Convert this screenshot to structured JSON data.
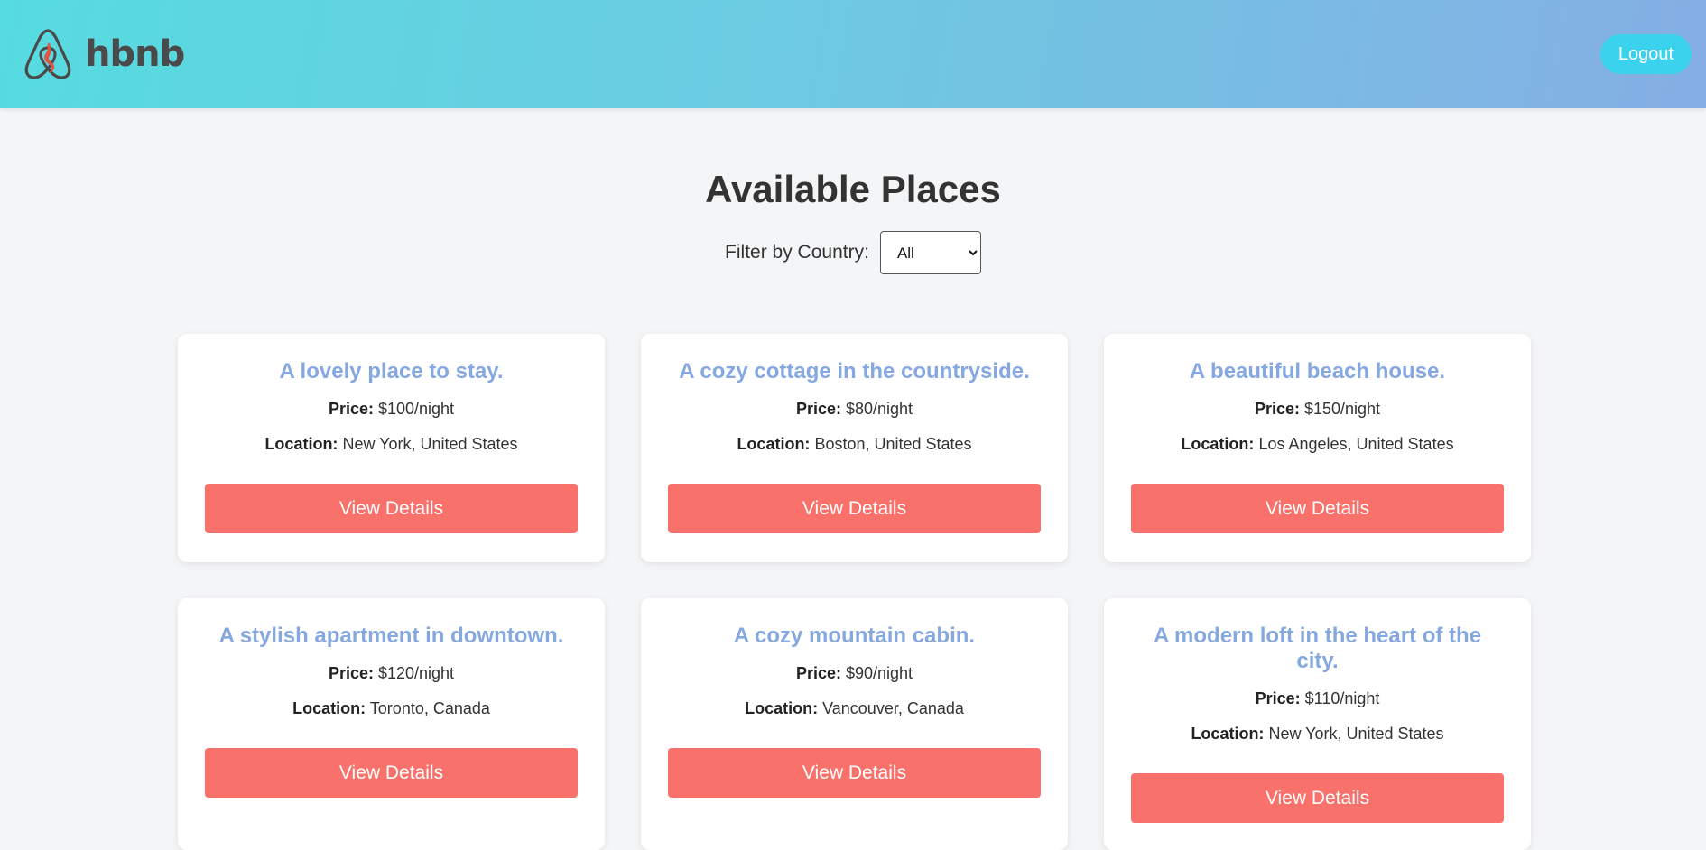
{
  "header": {
    "brand_name": "hbnb",
    "logout_label": "Logout",
    "colors": {
      "gradient_start": "#56dbe0",
      "gradient_end": "#85aee4",
      "logout_bg": "#3ad2ec"
    }
  },
  "main": {
    "title": "Available Places",
    "filter": {
      "label": "Filter by Country:",
      "selected": "All",
      "options": [
        "All"
      ]
    },
    "price_label": "Price:",
    "location_label": "Location:",
    "button_label": "View Details",
    "colors": {
      "card_title": "#86a8e0",
      "button_bg": "#f8716a"
    },
    "places": [
      {
        "title": "A lovely place to stay.",
        "price": "$100/night",
        "location": "New York, United States"
      },
      {
        "title": "A cozy cottage in the countryside.",
        "price": "$80/night",
        "location": "Boston, United States"
      },
      {
        "title": "A beautiful beach house.",
        "price": "$150/night",
        "location": "Los Angeles, United States"
      },
      {
        "title": "A stylish apartment in downtown.",
        "price": "$120/night",
        "location": "Toronto, Canada"
      },
      {
        "title": "A cozy mountain cabin.",
        "price": "$90/night",
        "location": "Vancouver, Canada"
      },
      {
        "title": "A modern loft in the heart of the city.",
        "price": "$110/night",
        "location": "New York, United States"
      }
    ]
  }
}
